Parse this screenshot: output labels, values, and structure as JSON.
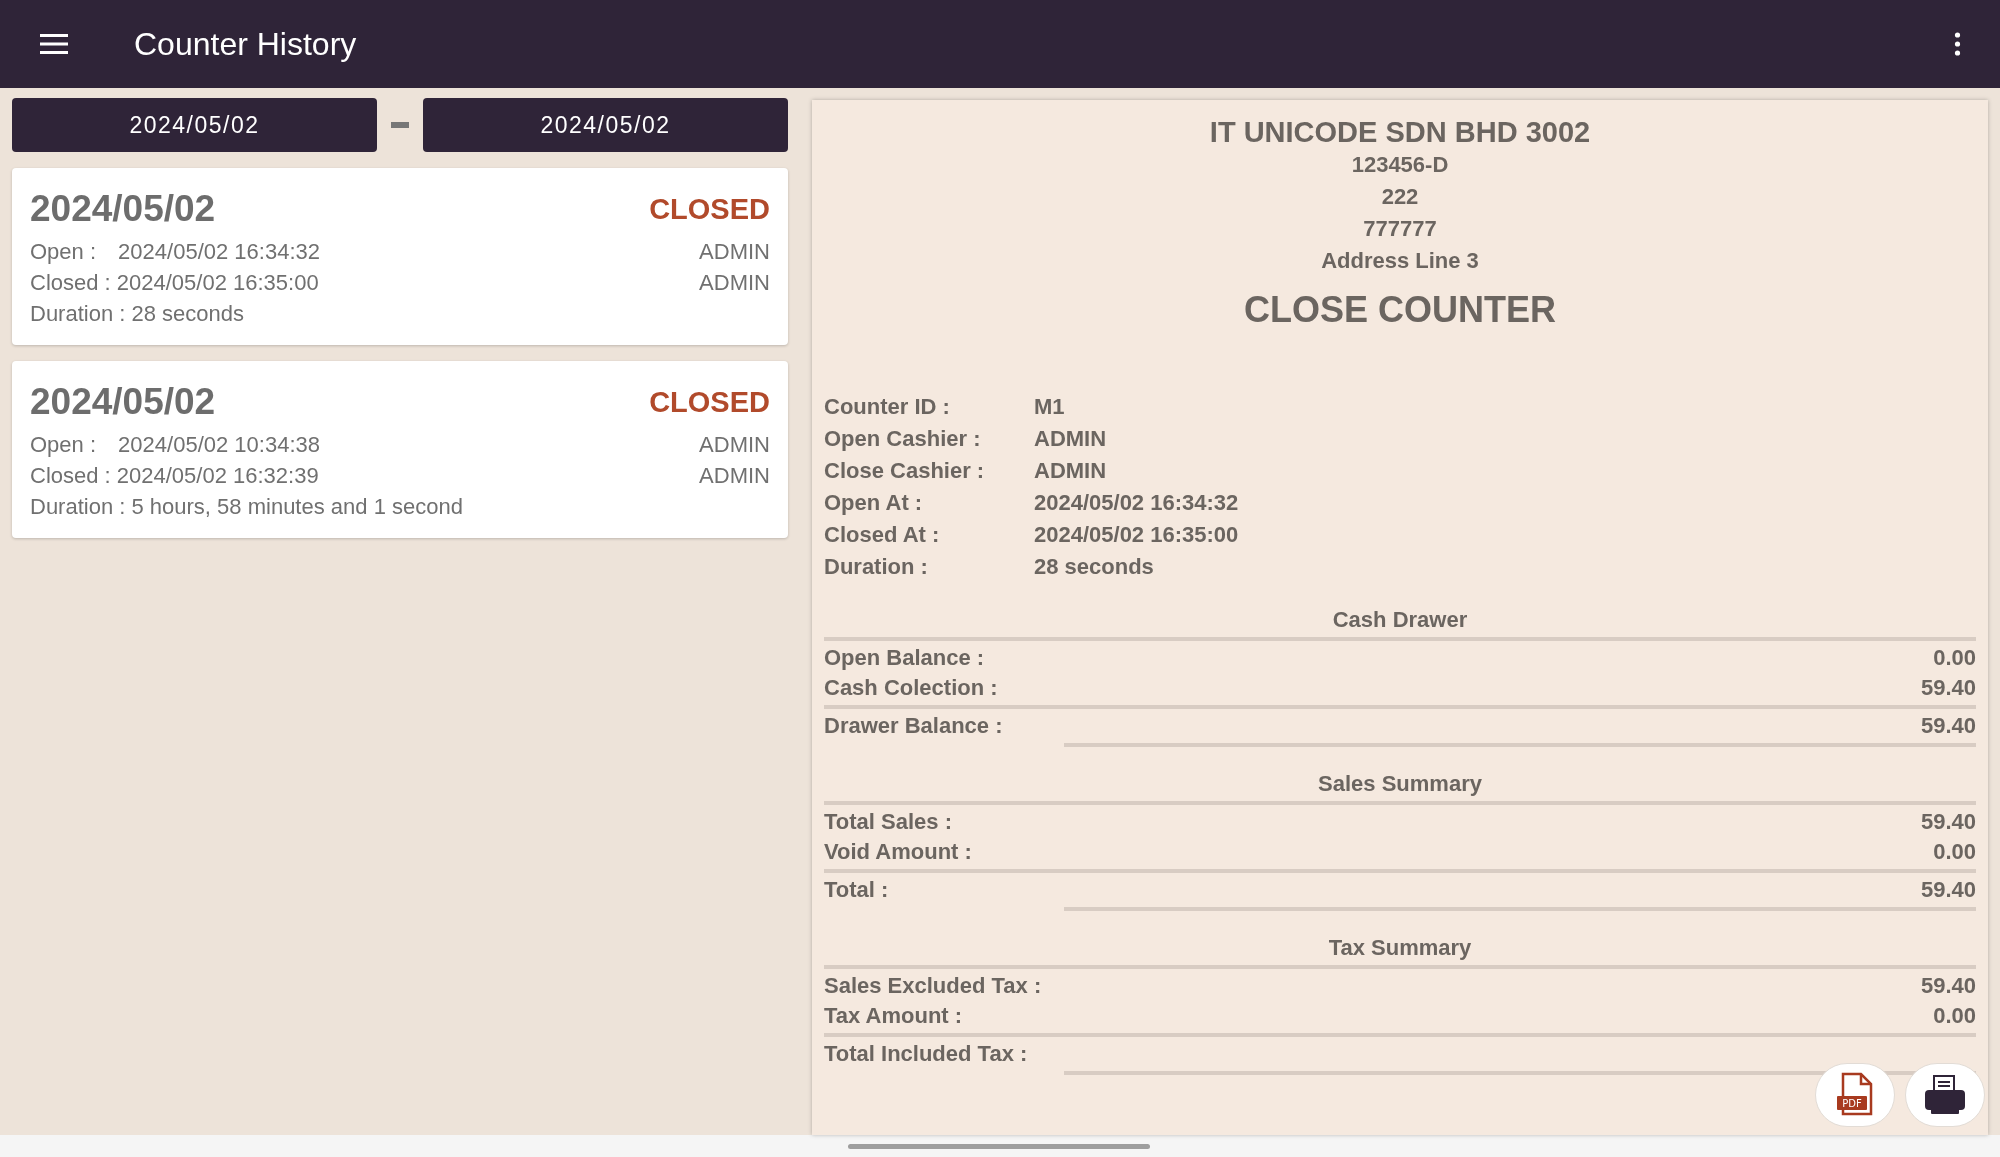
{
  "app_bar": {
    "title": "Counter History"
  },
  "date_range": {
    "from": "2024/05/02",
    "to": "2024/05/02"
  },
  "sessions": [
    {
      "date": "2024/05/02",
      "status": "CLOSED",
      "open_label": "Open :",
      "open_time": "2024/05/02 16:34:32",
      "open_by": "ADMIN",
      "closed_label": "Closed :",
      "closed_time": "2024/05/02 16:35:00",
      "closed_by": "ADMIN",
      "duration": "Duration : 28 seconds"
    },
    {
      "date": "2024/05/02",
      "status": "CLOSED",
      "open_label": "Open :",
      "open_time": "2024/05/02 10:34:38",
      "open_by": "ADMIN",
      "closed_label": "Closed :",
      "closed_time": "2024/05/02 16:32:39",
      "closed_by": "ADMIN",
      "duration": "Duration : 5 hours, 58 minutes and 1 second"
    }
  ],
  "receipt": {
    "company": "IT UNICODE SDN BHD 3002",
    "header_lines": [
      "123456-D",
      "222",
      "777777",
      "Address Line 3"
    ],
    "title": "CLOSE COUNTER",
    "info": [
      {
        "label": "Counter ID :",
        "value": "M1"
      },
      {
        "label": "Open Cashier :",
        "value": "ADMIN"
      },
      {
        "label": "Close Cashier :",
        "value": "ADMIN"
      },
      {
        "label": "Open At :",
        "value": "2024/05/02 16:34:32"
      },
      {
        "label": "Closed At :",
        "value": "2024/05/02 16:35:00"
      },
      {
        "label": "Duration :",
        "value": "28 seconds"
      }
    ],
    "sections": [
      {
        "heading": "Cash Drawer",
        "rows": [
          {
            "kind": "plain",
            "label": "Open Balance :",
            "value": "0.00"
          },
          {
            "kind": "plain",
            "label": "Cash Colection :",
            "value": "59.40"
          },
          {
            "kind": "total",
            "label": "Drawer Balance :",
            "value": "59.40"
          }
        ]
      },
      {
        "heading": "Sales Summary",
        "rows": [
          {
            "kind": "plain",
            "label": "Total Sales :",
            "value": "59.40"
          },
          {
            "kind": "plain",
            "label": "Void Amount :",
            "value": "0.00"
          },
          {
            "kind": "total",
            "label": "Total :",
            "value": "59.40"
          }
        ]
      },
      {
        "heading": "Tax Summary",
        "rows": [
          {
            "kind": "plain",
            "label": "Sales Excluded Tax :",
            "value": "59.40"
          },
          {
            "kind": "plain",
            "label": "Tax Amount :",
            "value": "0.00"
          },
          {
            "kind": "total",
            "label": "Total Included Tax :"
          }
        ]
      }
    ]
  },
  "actions": {
    "pdf_label": "PDF"
  }
}
